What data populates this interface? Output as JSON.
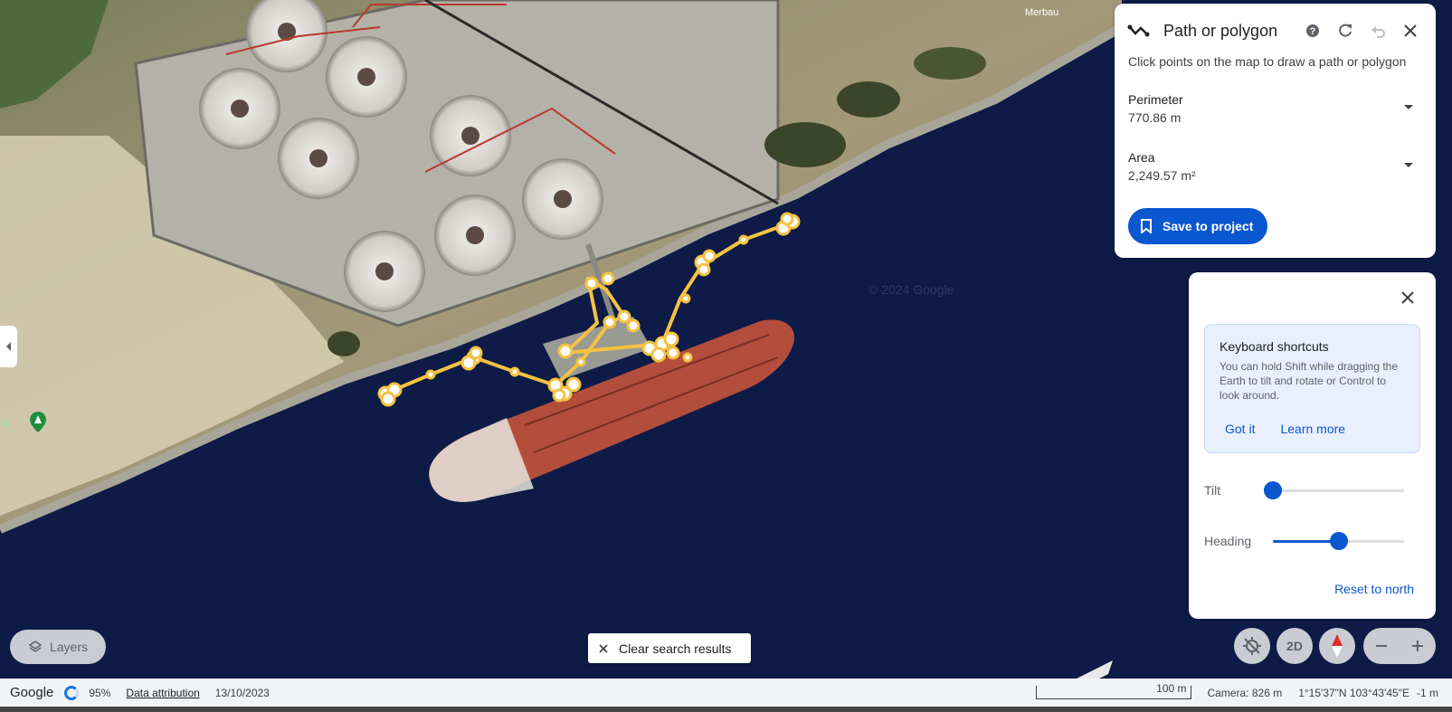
{
  "map": {
    "place_label": "Merbau",
    "pin_label": "ok",
    "watermark": "© 2024 Google"
  },
  "measure_panel": {
    "title": "Path or polygon",
    "hint": "Click points on the map to draw a path or polygon",
    "perimeter_label": "Perimeter",
    "perimeter_value": "770.86 m",
    "area_label": "Area",
    "area_value": "2,249.57 m²",
    "save_label": "Save to project"
  },
  "nav_panel": {
    "shortcuts_title": "Keyboard shortcuts",
    "shortcuts_body": "You can hold Shift while dragging the Earth to tilt and rotate or Control to look around.",
    "got_it": "Got it",
    "learn_more": "Learn more",
    "tilt_label": "Tilt",
    "tilt_value": 0,
    "heading_label": "Heading",
    "heading_value": 0.5,
    "reset_label": "Reset to north"
  },
  "controls": {
    "layers_label": "Layers",
    "mode_2d_label": "2D",
    "clear_label": "Clear search results"
  },
  "status_bar": {
    "brand": "Google",
    "load_percent": "95%",
    "attribution": "Data attribution",
    "date": "13/10/2023",
    "scale": "100 m",
    "camera": "Camera: 826 m",
    "coords": "1°15'37\"N 103°43'45\"E",
    "elevation": "-1 m"
  },
  "colors": {
    "accent": "#0b57d0",
    "path": "#f5c242",
    "water": "#0d1b46",
    "hull": "#b44e3c"
  }
}
